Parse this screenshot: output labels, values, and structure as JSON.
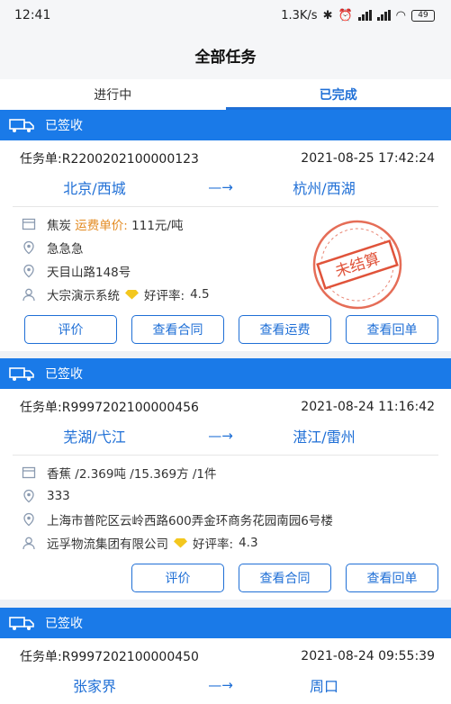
{
  "status": {
    "time": "12:41",
    "speed": "1.3K/s",
    "battery": "49"
  },
  "page_title": "全部任务",
  "tabs": [
    {
      "label": "进行中"
    },
    {
      "label": "已完成"
    }
  ],
  "cards": [
    {
      "status": "已签收",
      "order_label": "任务单:R2200202100000123",
      "datetime": "2021-08-25 17:42:24",
      "from": "北京/西城",
      "arrow": "—→",
      "to": "杭州/西湖",
      "goods": "焦炭",
      "freight_label": "运费单价:",
      "freight_value": "111元/吨",
      "line2": "急急急",
      "line3": "天目山路148号",
      "company": "大宗演示系统",
      "rating_label": "好评率:",
      "rating_value": "4.5",
      "stamp_text": "未结算",
      "buttons": [
        "评价",
        "查看合同",
        "查看运费",
        "查看回单"
      ]
    },
    {
      "status": "已签收",
      "order_label": "任务单:R9997202100000456",
      "datetime": "2021-08-24 11:16:42",
      "from": "芜湖/弋江",
      "arrow": "—→",
      "to": "湛江/雷州",
      "goods": "香蕉 /2.369吨 /15.369方 /1件",
      "line2": "333",
      "line3": "上海市普陀区云岭西路600弄金环商务花园南园6号楼",
      "company": "远孚物流集团有限公司",
      "rating_label": "好评率:",
      "rating_value": "4.3",
      "buttons": [
        "评价",
        "查看合同",
        "查看回单"
      ]
    },
    {
      "status": "已签收",
      "order_label": "任务单:R9997202100000450",
      "datetime": "2021-08-24 09:55:39",
      "from": "张家界",
      "arrow": "—→",
      "to": "周口"
    }
  ],
  "colors": {
    "primary": "#1a7ae8",
    "accent_text": "#1f6fd6",
    "stamp": "#e0533a",
    "highlight": "#e38b22"
  }
}
